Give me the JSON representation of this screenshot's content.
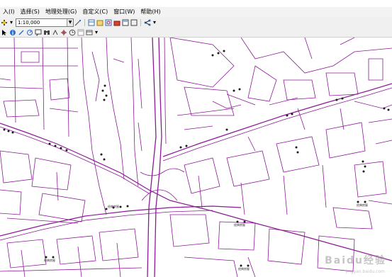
{
  "menubar": {
    "items": [
      "入(I)",
      "选择(S)",
      "地理处理(G)",
      "自定义(C)",
      "窗口(W)",
      "帮助(H)"
    ]
  },
  "toolbar": {
    "scale_value": "1:10,000"
  },
  "map": {
    "line_color": "#8b1a96",
    "poi_labels": [
      "经典房屋",
      "经典房屋",
      "经典房屋",
      "经典房屋",
      "经典房屋"
    ]
  },
  "watermark": {
    "text": "Baidu经验",
    "sub": "jingyan.baidu.com"
  }
}
